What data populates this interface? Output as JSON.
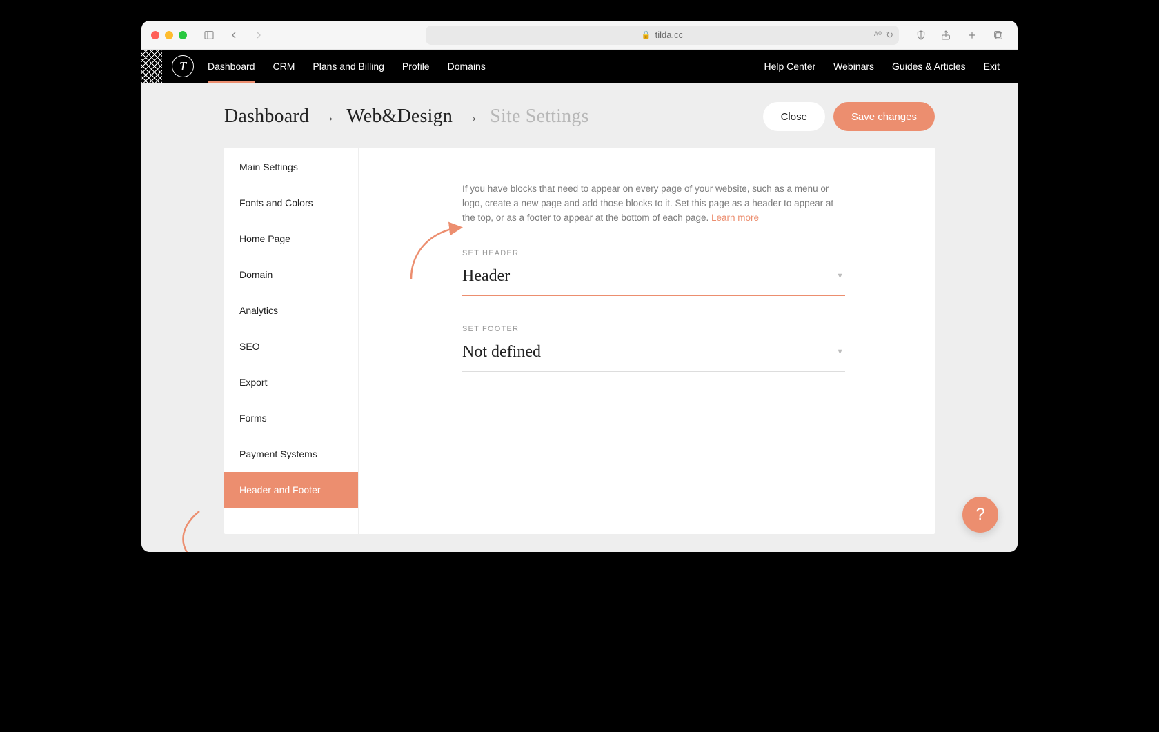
{
  "browser": {
    "url_host": "tilda.cc"
  },
  "topnav": {
    "logo_letter": "T",
    "left": [
      "Dashboard",
      "CRM",
      "Plans and Billing",
      "Profile",
      "Domains"
    ],
    "active_index": 0,
    "right": [
      "Help Center",
      "Webinars",
      "Guides & Articles",
      "Exit"
    ]
  },
  "breadcrumb": {
    "items": [
      "Dashboard",
      "Web&Design",
      "Site Settings"
    ],
    "muted_index": 2
  },
  "actions": {
    "close": "Close",
    "save": "Save changes"
  },
  "sidebar": {
    "items": [
      "Main Settings",
      "Fonts and Colors",
      "Home Page",
      "Domain",
      "Analytics",
      "SEO",
      "Export",
      "Forms",
      "Payment Systems",
      "Header and Footer"
    ],
    "active_index": 9
  },
  "content": {
    "help_text": "If you have blocks that need to appear on every page of your website, such as a menu or logo, create a new page and add those blocks to it. Set this page as a header to appear at the top, or as a footer to appear at the bottom of each page. ",
    "learn_more": "Learn more",
    "header_label": "SET HEADER",
    "header_value": "Header",
    "footer_label": "SET FOOTER",
    "footer_value": "Not defined"
  },
  "fab": {
    "label": "?"
  }
}
